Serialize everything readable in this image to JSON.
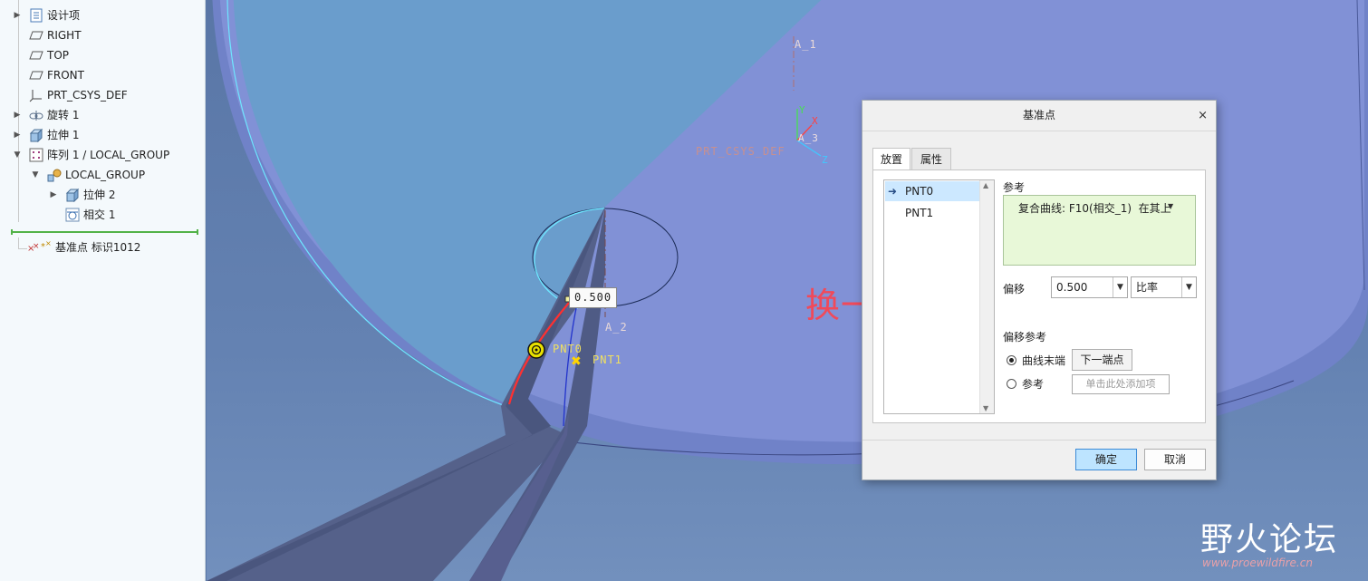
{
  "model_tree": {
    "items": [
      {
        "label": "设计项",
        "icon": "design-items-icon",
        "expandable": true
      },
      {
        "label": "RIGHT",
        "icon": "datum-plane-icon",
        "expandable": false
      },
      {
        "label": "TOP",
        "icon": "datum-plane-icon",
        "expandable": false
      },
      {
        "label": "FRONT",
        "icon": "datum-plane-icon",
        "expandable": false
      },
      {
        "label": "PRT_CSYS_DEF",
        "icon": "coordinate-system-icon",
        "expandable": false
      },
      {
        "label": "旋转 1",
        "icon": "revolve-icon",
        "expandable": true
      },
      {
        "label": "拉伸 1",
        "icon": "extrude-icon",
        "expandable": true
      },
      {
        "label": "阵列 1 / LOCAL_GROUP",
        "icon": "pattern-icon",
        "expandable": true,
        "expanded": true
      },
      {
        "label": "LOCAL_GROUP",
        "icon": "group-icon",
        "expandable": true,
        "expanded": true
      },
      {
        "label": "拉伸 2",
        "icon": "extrude-icon",
        "expandable": true
      },
      {
        "label": "相交 1",
        "icon": "intersect-icon",
        "expandable": false
      }
    ],
    "insert_item": {
      "label": "基准点 标识1012",
      "icon": "datum-point-icon"
    }
  },
  "viewport": {
    "labels": {
      "axis_a1": "A_1",
      "axis_a2": "A_2",
      "axis_a3": "A_3",
      "csys": "PRT_CSYS_DEF",
      "csys_x": "X",
      "csys_y": "Y",
      "csys_z": "Z",
      "offset_value": "0.500",
      "pnt0": "PNT0",
      "pnt1": "PNT1"
    }
  },
  "dialog": {
    "title": "基准点",
    "close_glyph": "×",
    "tabs": [
      {
        "label": "放置",
        "active": true
      },
      {
        "label": "属性",
        "active": false
      }
    ],
    "points": [
      {
        "label": "PNT0",
        "selected": true
      },
      {
        "label": "PNT1",
        "selected": false
      }
    ],
    "reference_label": "参考",
    "reference_value": "复合曲线: F10(相交_1)  在其上",
    "offset_label": "偏移",
    "offset_value": "0.500",
    "offset_mode": "比率",
    "offset_ref_label": "偏移参考",
    "offset_ref_options": [
      {
        "label": "曲线末端",
        "selected": true
      },
      {
        "label": "参考",
        "selected": false
      }
    ],
    "next_end_button": "下一端点",
    "add_item_placeholder": "单击此处添加项",
    "ok_button": "确定",
    "cancel_button": "取消"
  },
  "annotation": {
    "text": "换一下选择",
    "color": "#f04a5a"
  },
  "watermark": {
    "text": "野火论坛",
    "url": "www.proewildfire.cn"
  },
  "colors": {
    "selection_blue": "#cce8ff",
    "reference_green": "#e8f8d8",
    "ok_button": "#bde4ff",
    "tree_separator": "#52b248",
    "model_face": "#7f8fd6"
  }
}
